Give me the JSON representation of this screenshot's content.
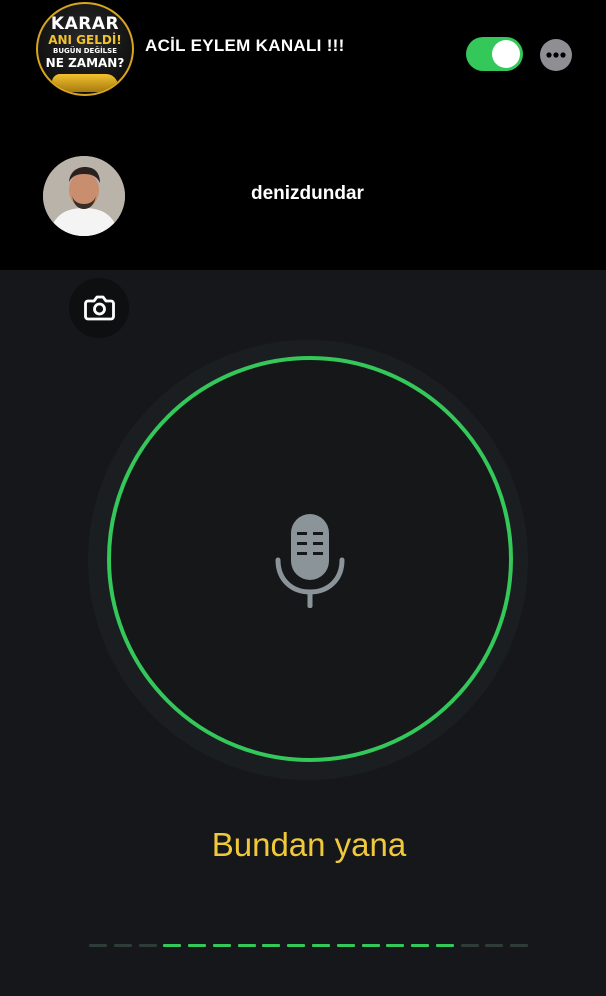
{
  "header": {
    "channel_logo_text": [
      "KARAR",
      "ANI GELDİ!",
      "BUGÜN DEĞİLSE",
      "NE ZAMAN?"
    ],
    "channel_title": "ACİL EYLEM KANALI !!!",
    "toggle_on": true,
    "toggle_color": "#34c759",
    "more_icon": "ellipsis-icon"
  },
  "speaker": {
    "username": "denizdundar",
    "avatar": "profile-photo"
  },
  "panel": {
    "camera_icon": "camera-icon",
    "mic_icon": "microphone-icon",
    "ring_color": "#34c759",
    "caption": "Bundan yana",
    "caption_color": "#f0c93a"
  },
  "progress": {
    "total_segments": 18,
    "active_start": 3,
    "active_end": 15,
    "active_color": "#34c759",
    "inactive_color": "#2e3b36"
  }
}
